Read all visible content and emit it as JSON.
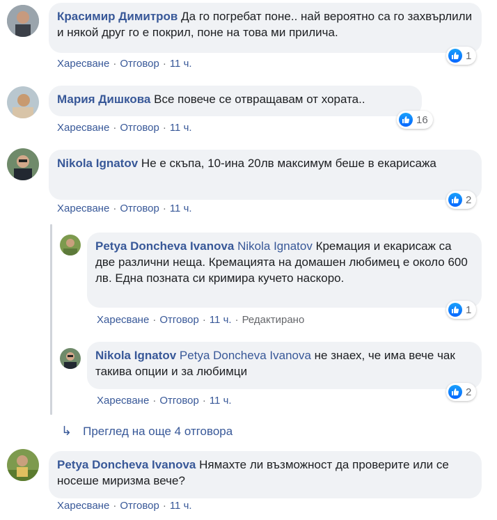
{
  "colors": {
    "link": "#385898",
    "bubble": "#f0f2f5",
    "meta": "#65676b",
    "like": "#0866ff"
  },
  "comments": [
    {
      "author": "Красимир Димитров",
      "text": "Да го погребат поне.. най вероятно са го захвърлили и някой друг го е покрил, поне на това ми прилича.",
      "like": "Харесване",
      "reply": "Отговор",
      "time": "11 ч.",
      "reactions": "1"
    },
    {
      "author": "Мария Дишкова",
      "text": "Все повече се отвращавам от хората..",
      "like": "Харесване",
      "reply": "Отговор",
      "time": "11 ч.",
      "reactions": "16"
    },
    {
      "author": "Nikola Ignatov",
      "text": "Не е скъпа, 10-ина 20лв максимум беше в екарисажа",
      "like": "Харесване",
      "reply": "Отговор",
      "time": "11 ч.",
      "reactions": "2"
    },
    {
      "author": "Petya Doncheva Ivanova",
      "mention": "Nikola Ignatov",
      "text": "Кремация и екарисаж са две различни неща. Кремацията на домашен любимец е около 600 лв. Една позната си кримира кучето наскоро.",
      "like": "Харесване",
      "reply": "Отговор",
      "time": "11 ч.",
      "edited": "Редактирано",
      "reactions": "1"
    },
    {
      "author": "Nikola Ignatov",
      "mention": "Petya Doncheva Ivanova",
      "text": "не знаех, че има вече чак такива опции и за любимци",
      "like": "Харесване",
      "reply": "Отговор",
      "time": "11 ч.",
      "reactions": "2"
    },
    {
      "author": "Petya Doncheva Ivanova",
      "text": "Нямахте ли възможност да проверите или се носеше миризма вече?",
      "like": "Харесване",
      "reply": "Отговор",
      "time": "11 ч."
    }
  ],
  "more_replies": {
    "label": "Преглед на още 4 отговора",
    "icon": "reply-arrow-icon"
  },
  "separator": "·"
}
